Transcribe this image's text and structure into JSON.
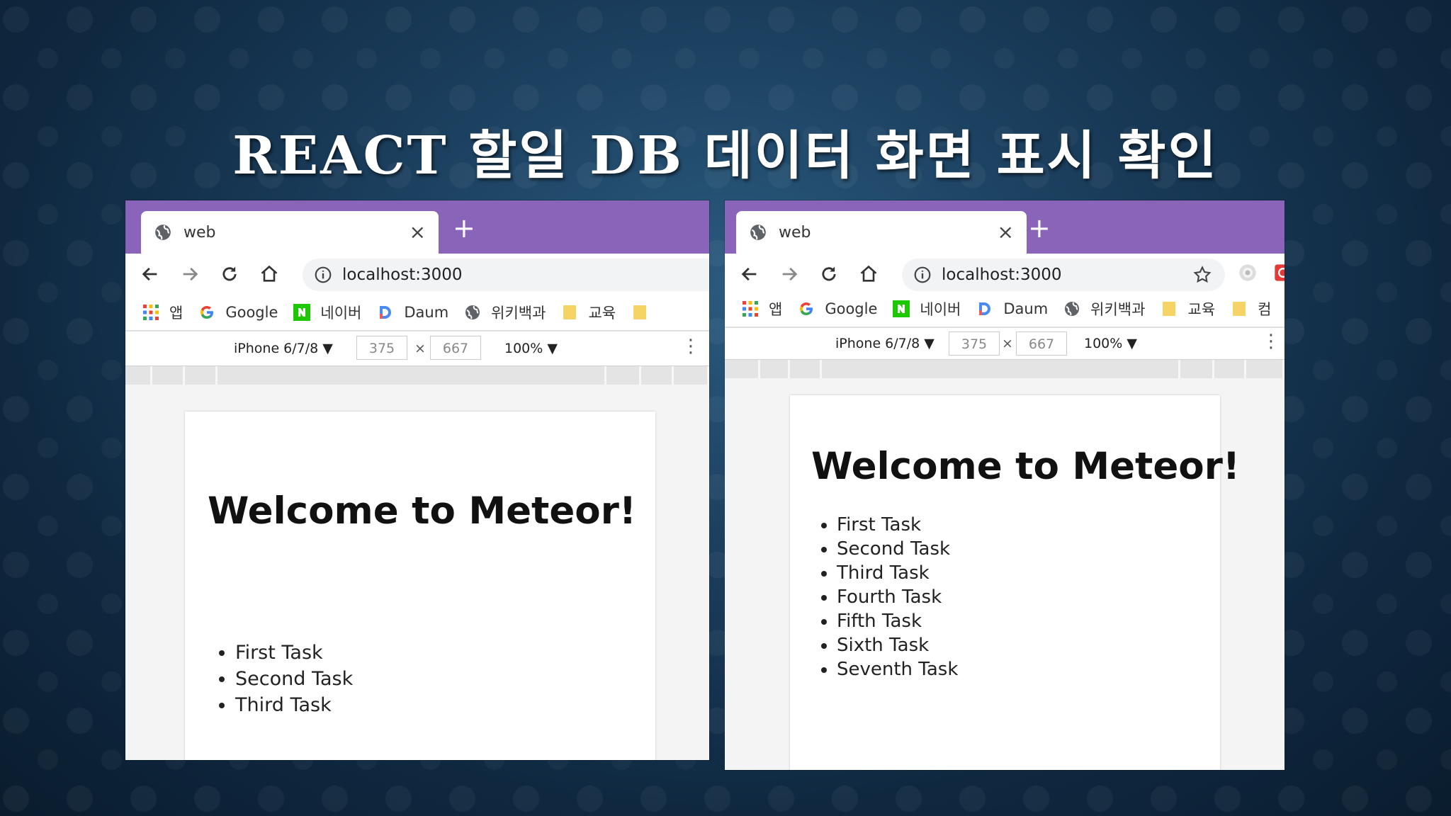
{
  "slide": {
    "title": "REACT 할일 DB 데이터 화면 표시 확인"
  },
  "left_browser": {
    "tab": {
      "title": "web",
      "close": "×"
    },
    "new_tab": "+",
    "address": {
      "url": "localhost:3000"
    },
    "bookmarks": [
      {
        "label": "앱",
        "icon": "apps-grid-icon"
      },
      {
        "label": "Google",
        "icon": "google-icon"
      },
      {
        "label": "네이버",
        "icon": "naver-icon"
      },
      {
        "label": "Daum",
        "icon": "daum-icon"
      },
      {
        "label": "위키백과",
        "icon": "wikipedia-icon"
      },
      {
        "label": "교육",
        "icon": "folder-icon"
      }
    ],
    "device_toolbar": {
      "device": "iPhone 6/7/8 ▼",
      "width": "375",
      "times": "×",
      "height": "667",
      "zoom": "100% ▼",
      "more": "⋮"
    },
    "page": {
      "heading": "Welcome to Meteor!",
      "tasks": [
        "First Task",
        "Second Task",
        "Third Task"
      ]
    }
  },
  "right_browser": {
    "tab": {
      "title": "web",
      "close": "×"
    },
    "new_tab": "+",
    "address": {
      "url": "localhost:3000"
    },
    "bookmarks": [
      {
        "label": "앱",
        "icon": "apps-grid-icon"
      },
      {
        "label": "Google",
        "icon": "google-icon"
      },
      {
        "label": "네이버",
        "icon": "naver-icon"
      },
      {
        "label": "Daum",
        "icon": "daum-icon"
      },
      {
        "label": "위키백과",
        "icon": "wikipedia-icon"
      },
      {
        "label": "교육",
        "icon": "folder-icon"
      },
      {
        "label": "컴",
        "icon": "folder-icon"
      }
    ],
    "device_toolbar": {
      "device": "iPhone 6/7/8 ▼",
      "width": "375",
      "times": "×",
      "height": "667",
      "zoom": "100% ▼",
      "more": "⋮"
    },
    "page": {
      "heading": "Welcome to Meteor!",
      "tasks": [
        "First Task",
        "Second Task",
        "Third Task",
        "Fourth Task",
        "Fifth Task",
        "Sixth Task",
        "Seventh Task"
      ]
    }
  },
  "colors": {
    "tabstrip": "#8a64b8",
    "background": "#1b3f5e",
    "title_text": "#ffffff"
  }
}
